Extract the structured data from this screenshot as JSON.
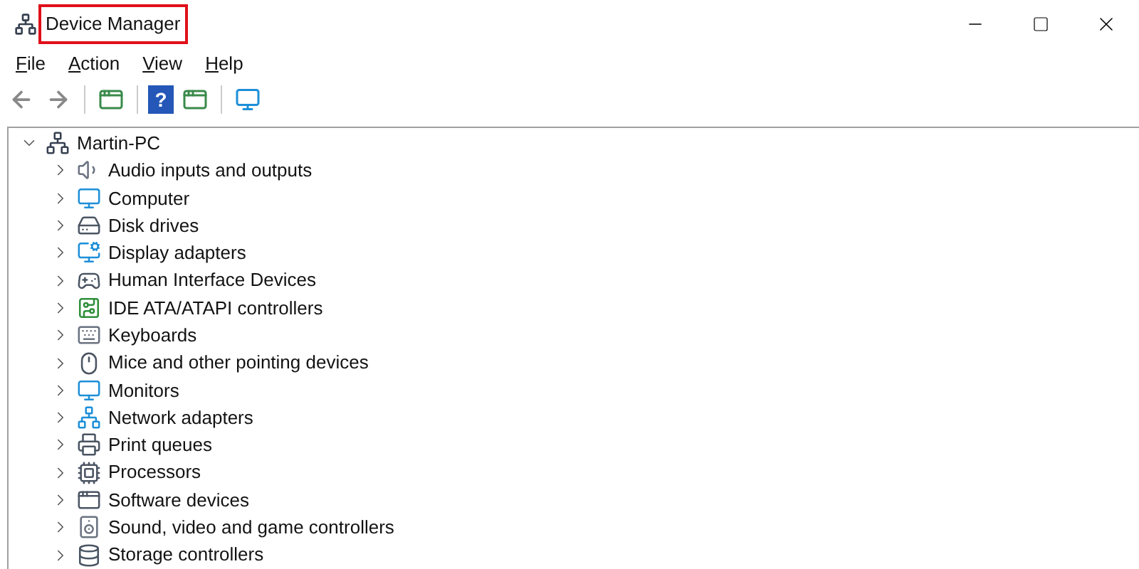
{
  "window": {
    "title": "Device Manager",
    "title_highlighted": true
  },
  "menu": [
    "File",
    "Action",
    "View",
    "Help"
  ],
  "toolbar": {
    "help_glyph": "?"
  },
  "tree": {
    "label": "Martin-PC",
    "expanded": true,
    "children": [
      {
        "label": "Audio inputs and outputs",
        "expanded": false
      },
      {
        "label": "Computer",
        "expanded": false
      },
      {
        "label": "Disk drives",
        "expanded": false
      },
      {
        "label": "Display adapters",
        "expanded": false
      },
      {
        "label": "Human Interface Devices",
        "expanded": false
      },
      {
        "label": "IDE ATA/ATAPI controllers",
        "expanded": false
      },
      {
        "label": "Keyboards",
        "expanded": false
      },
      {
        "label": "Mice and other pointing devices",
        "expanded": false
      },
      {
        "label": "Monitors",
        "expanded": false
      },
      {
        "label": "Network adapters",
        "expanded": false
      },
      {
        "label": "Print queues",
        "expanded": false
      },
      {
        "label": "Processors",
        "expanded": false
      },
      {
        "label": "Software devices",
        "expanded": false
      },
      {
        "label": "Sound, video and game controllers",
        "expanded": false
      },
      {
        "label": "Storage controllers",
        "expanded": false
      }
    ]
  }
}
